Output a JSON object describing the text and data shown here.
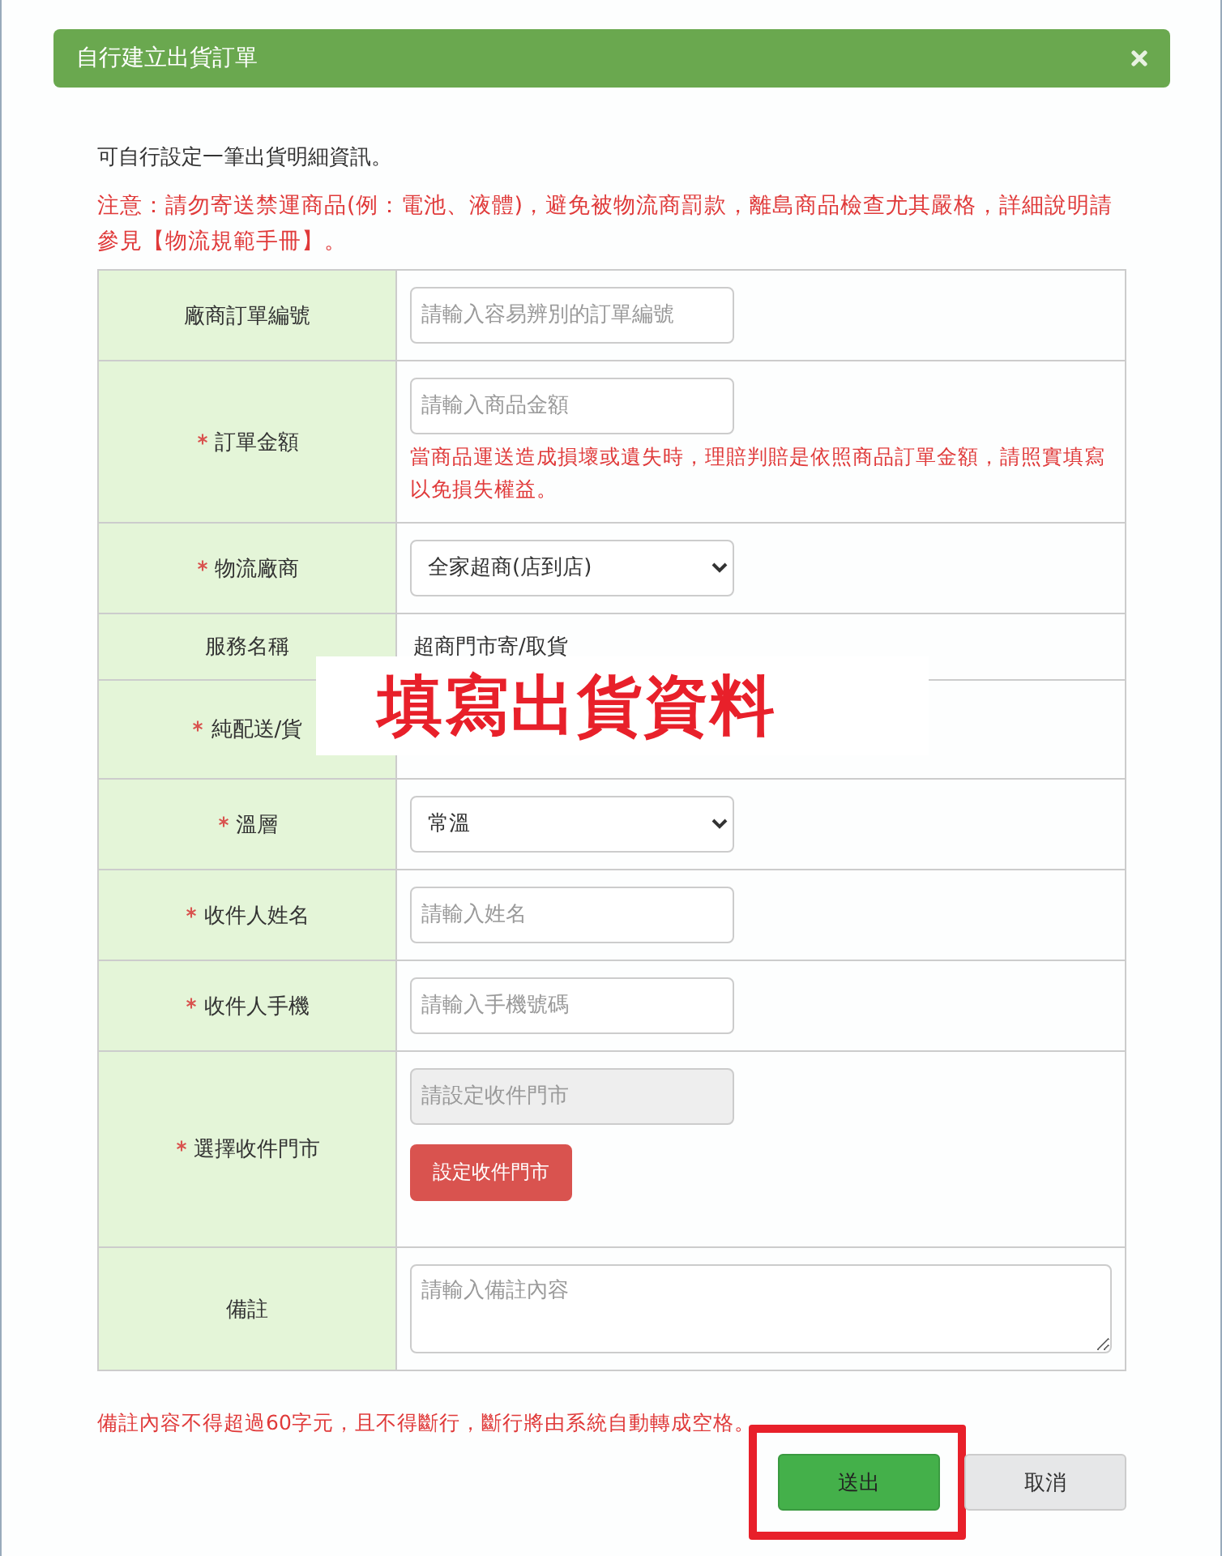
{
  "dialog": {
    "title": "自行建立出貨訂單"
  },
  "intro": "可自行設定一筆出貨明細資訊。",
  "notice": "注意：請勿寄送禁運商品(例：電池、液體)，避免被物流商罰款，離島商品檢查尤其嚴格，詳細說明請參見【物流規範手冊】。",
  "form_rows": [
    {
      "label": "廠商訂單編號",
      "required": false,
      "kind": "input",
      "placeholder": "請輸入容易辨別的訂單編號"
    },
    {
      "label": "訂單金額",
      "required": true,
      "kind": "input",
      "placeholder": "請輸入商品金額",
      "hint": "當商品運送造成損壞或遺失時，理賠判賠是依照商品訂單金額，請照實填寫以免損失權益。"
    },
    {
      "label": "物流廠商",
      "required": true,
      "kind": "select",
      "value": "全家超商(店到店)"
    },
    {
      "label": "服務名稱",
      "required": false,
      "kind": "static",
      "value": "超商門市寄/取貨"
    },
    {
      "label": "純配送/貨",
      "required": true,
      "kind": "blank"
    },
    {
      "label": "溫層",
      "required": true,
      "kind": "select",
      "value": "常溫"
    },
    {
      "label": "收件人姓名",
      "required": true,
      "kind": "input",
      "placeholder": "請輸入姓名"
    },
    {
      "label": "收件人手機",
      "required": true,
      "kind": "input",
      "placeholder": "請輸入手機號碼"
    },
    {
      "label": "選擇收件門市",
      "required": true,
      "kind": "store",
      "placeholder": "請設定收件門市",
      "button": "設定收件門市"
    },
    {
      "label": "備註",
      "required": false,
      "kind": "textarea",
      "placeholder": "請輸入備註內容"
    }
  ],
  "footnote": "備註內容不得超過60字元，且不得斷行，斷行將由系統自動轉成空格。",
  "buttons": [
    {
      "label": "送出",
      "kind": "primary",
      "highlighted": true
    },
    {
      "label": "取消",
      "kind": "default",
      "highlighted": false
    }
  ],
  "overlay_caption": "填寫出貨資料"
}
